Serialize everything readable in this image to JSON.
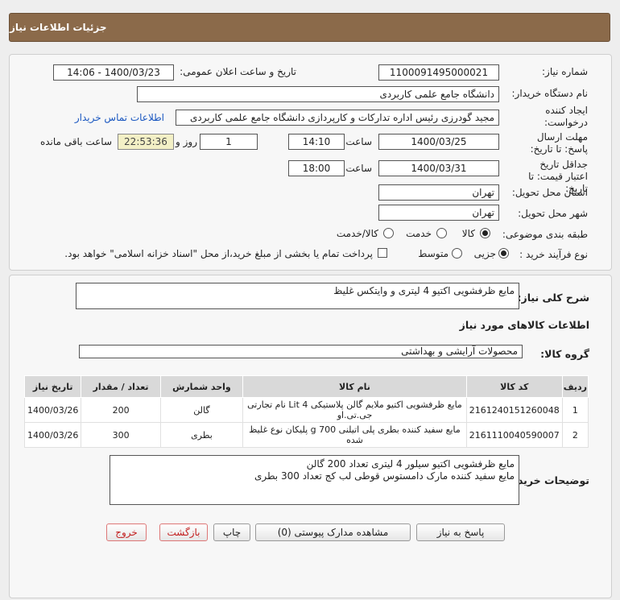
{
  "header": {
    "title": "جزئیات اطلاعات نیاز"
  },
  "form": {
    "need_number_label": "شماره نیاز:",
    "need_number": "1100091495000021",
    "announce_label": "تاریخ و ساعت اعلان عمومی:",
    "announce_value": "1400/03/23 - 14:06",
    "buyer_label": "نام دستگاه خریدار:",
    "buyer_value": "دانشگاه جامع علمی کاربردی",
    "creator_label": "ایجاد کننده درخواست:",
    "creator_value": "مجید گودرزی رئیس اداره تدارکات و کارپردازی دانشگاه جامع علمی کاربردی",
    "contact_link": "اطلاعات تماس خریدار",
    "deadline_label": "مهلت ارسال پاسخ: تا تاریخ:",
    "deadline_date": "1400/03/25",
    "time_label": "ساعت",
    "deadline_time": "14:10",
    "days_value": "1",
    "days_label": "روز و",
    "remaining_time": "22:53:36",
    "remaining_label": "ساعت باقی مانده",
    "validity_label": "جداقل تاریخ اعتبار قیمت: تا تاریخ:",
    "validity_date": "1400/03/31",
    "validity_time": "18:00",
    "province_label": "استان محل تحویل:",
    "province_value": "تهران",
    "city_label": "شهر محل تحویل:",
    "city_value": "تهران",
    "category_label": "طبقه بندی موضوعی:",
    "category_options": [
      "کالا",
      "خدمت",
      "کالا/خدمت"
    ],
    "category_selected": "کالا",
    "purchase_label": "نوع فرآیند خرید :",
    "purchase_options": [
      "جزیی",
      "متوسط"
    ],
    "purchase_selected": "جزیی",
    "purchase_note": "پرداخت تمام یا بخشی از مبلغ خرید،از محل \"اسناد خزانه اسلامی\" خواهد بود."
  },
  "details": {
    "summary_label": "شرح کلی نیاز:",
    "summary_value": "مایع ظرفشویی اکتیو 4 لیتری و وایتکس غلیظ",
    "goods_info_title": "اطلاعات کالاهای مورد نیاز",
    "group_label": "گروه کالا:",
    "group_value": "محصولات آرایشی و بهداشتی",
    "table": {
      "headers": [
        "ردیف",
        "کد کالا",
        "نام کالا",
        "واحد شمارش",
        "تعداد / مقدار",
        "تاریخ نیاز"
      ],
      "rows": [
        [
          "1",
          "2161240151260048",
          "مایع ظرفشویی اکتیو ملایم گالن پلاستیکی 4 Lit نام تجارتی جی.تی.او",
          "گالن",
          "200",
          "1400/03/26"
        ],
        [
          "2",
          "2161110040590007",
          "مایع سفید کننده بطری پلی اتیلنی 700 g پلیکان نوع غلیظ شده",
          "بطری",
          "300",
          "1400/03/26"
        ]
      ]
    },
    "notes_label": "توضیحات خریدار:",
    "notes_line1": "مایع ظرفشویی اکتیو  سیلور  4 لیتری تعداد 200 گالن",
    "notes_line2": "مایع سفید کننده مارک دامستوس قوطی لب کج تعداد 300 بطری"
  },
  "buttons": {
    "reply": "پاسخ به نیاز",
    "attachments": "مشاهده مدارک پیوستی (0)",
    "print": "چاپ",
    "back": "بازگشت",
    "exit": "خروج"
  },
  "colors": {
    "header_bg": "#8b6a4a",
    "link": "#1a57c0",
    "remaining_bg": "#f3f0c6",
    "exit_text": "#c21f1f"
  }
}
